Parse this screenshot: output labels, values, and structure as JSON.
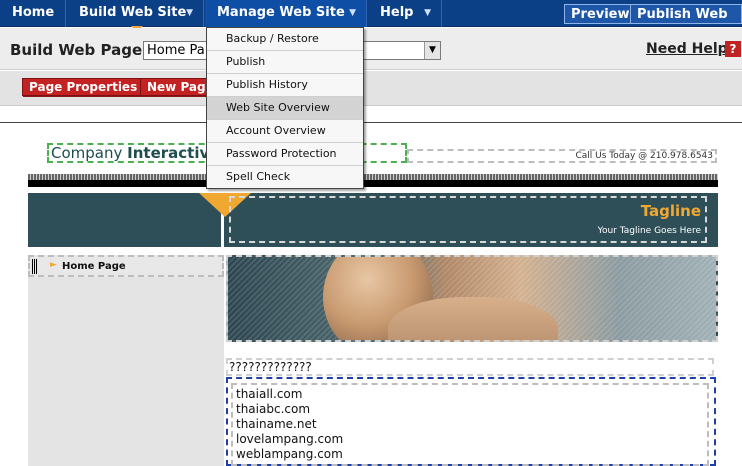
{
  "nav": {
    "home": "Home",
    "build": "Build Web Site",
    "manage": "Manage Web Site",
    "help": "Help",
    "preview": "Preview",
    "publish": "Publish Web Site",
    "arrow": "▼"
  },
  "toolbar": {
    "label": "Build Web Pages:",
    "page_select_value": "Home Pa",
    "need_help": "Need Help?",
    "help_icon": "?"
  },
  "actions": {
    "page_properties": "Page Properties",
    "new_page": "New Page"
  },
  "manage_menu": {
    "items": [
      "Backup / Restore",
      "Publish",
      "Publish History",
      "Web Site Overview",
      "Account Overview",
      "Password Protection",
      "Spell Check"
    ],
    "highlighted": "Web Site Overview"
  },
  "site": {
    "company_prefix": "Company ",
    "company_bold": "Interactive",
    "call_us": "Call Us Today @ 210.978.6543",
    "tagline": "Tagline",
    "tagline_sub": "Your Tagline Goes Here",
    "left_nav": [
      {
        "label": "Home Page"
      }
    ],
    "question_text": "?????????????",
    "links": [
      "thaiall.com",
      "thaiabc.com",
      "thainame.net",
      "lovelampang.com",
      "weblampang.com"
    ]
  },
  "icons": {
    "dropdown": "chevron-down-icon",
    "help": "help-icon",
    "nav_arrow": "arrow-right-icon"
  },
  "colors": {
    "nav_bg": "#0b3f86",
    "accent_orange": "#f0a830",
    "red_button": "#c42222",
    "banner_teal": "#2e4f58"
  }
}
